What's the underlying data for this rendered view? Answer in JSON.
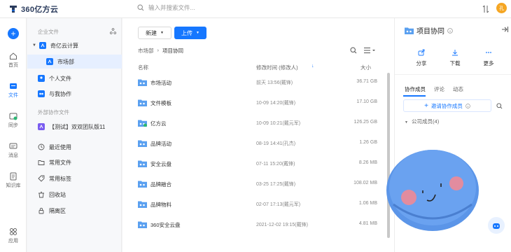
{
  "app": {
    "name": "360亿方云",
    "search_placeholder": "输入并搜索文件...",
    "avatar_text": "孔"
  },
  "nav": {
    "add_label": "+",
    "items": [
      {
        "label": "首页",
        "icon": "home-icon",
        "active": false
      },
      {
        "label": "文件",
        "icon": "file-icon",
        "active": true
      },
      {
        "label": "同步",
        "icon": "sync-icon",
        "active": false
      },
      {
        "label": "消息",
        "icon": "message-icon",
        "active": false
      },
      {
        "label": "知识库",
        "icon": "knowledge-icon",
        "active": false
      },
      {
        "label": "应用",
        "icon": "apps-icon",
        "active": false
      }
    ]
  },
  "tree": {
    "enterprise_heading": "企业文件",
    "company": "奇亿云计算",
    "department": "市场部",
    "personal": "个人文件",
    "shared": "与我协作",
    "external_heading": "外部协作文件",
    "external_team": "【测试】双双团队版11",
    "recent": "最近使用",
    "common_files": "常用文件",
    "common_tags": "常用标签",
    "recycle": "回收站",
    "isolation": "隔离区"
  },
  "toolbar": {
    "new_label": "新建",
    "upload_label": "上传"
  },
  "breadcrumb": {
    "parent": "市场部",
    "current": "项目协同"
  },
  "table": {
    "col_name": "名称",
    "col_time": "修改时间 (修改人)",
    "col_size": "大小",
    "rows": [
      {
        "name": "市场活动",
        "time": "前天 13:56(戴锋)",
        "size": "36.71 GB",
        "kind": "team"
      },
      {
        "name": "文件模板",
        "time": "10-09 14:20(戴锋)",
        "size": "17.10 GB",
        "kind": "team"
      },
      {
        "name": "亿方云",
        "time": "10-09 10:21(戴元军)",
        "size": "126.25 GB",
        "kind": "green"
      },
      {
        "name": "品牌活动",
        "time": "08-19 14:41(孔杰)",
        "size": "1.26 GB",
        "kind": "team"
      },
      {
        "name": "安全云盘",
        "time": "07-11 15:20(戴锋)",
        "size": "8.26 MB",
        "kind": "team"
      },
      {
        "name": "品牌融合",
        "time": "03-25 17:25(戴锋)",
        "size": "108.02 MB",
        "kind": "team"
      },
      {
        "name": "品牌物料",
        "time": "02-07 17:13(戴元军)",
        "size": "1.06 MB",
        "kind": "team"
      },
      {
        "name": "360安全云盘",
        "time": "2021-12-02 19:15(戴锋)",
        "size": "4.81 MB",
        "kind": "team"
      }
    ]
  },
  "panel": {
    "title": "项目协同",
    "share": "分享",
    "download": "下载",
    "more": "更多",
    "tab_members": "协作成员",
    "tab_comments": "评论",
    "tab_activity": "动态",
    "invite": "邀请协作成员",
    "company_members": "公司成员(4)"
  },
  "colors": {
    "accent": "#1677ff",
    "folder": "#5aa0f0",
    "green": "#2bb673",
    "mascot": "#5b95e8"
  }
}
